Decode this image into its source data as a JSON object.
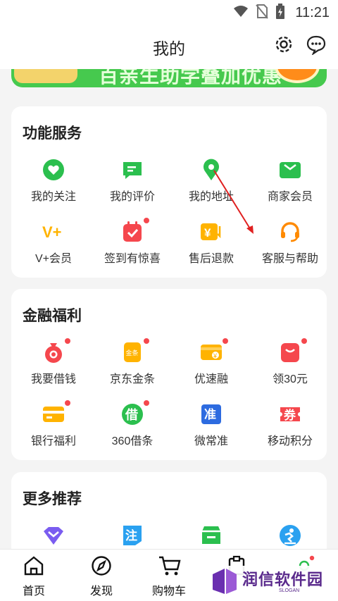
{
  "status_bar": {
    "time": "11:21",
    "icons": [
      "wifi-icon",
      "no-sim-icon",
      "battery-charging-icon"
    ]
  },
  "header": {
    "title": "我的",
    "icons": [
      "gear-icon",
      "message-bubble-icon"
    ]
  },
  "banner": {
    "text": "百亲生助学叠加优惠"
  },
  "services": {
    "title": "功能服务",
    "items": [
      {
        "label": "我的关注",
        "icon": "heart-icon",
        "color": "#2bbf4e",
        "badge": false
      },
      {
        "label": "我的评价",
        "icon": "comment-icon",
        "color": "#2bbf4e",
        "badge": false
      },
      {
        "label": "我的地址",
        "icon": "location-pin-icon",
        "color": "#2bbf4e",
        "badge": false
      },
      {
        "label": "商家会员",
        "icon": "member-card-icon",
        "color": "#2bbf4e",
        "badge": false
      },
      {
        "label": "V+会员",
        "icon": "vplus-icon",
        "color": "#ffb300",
        "badge": false
      },
      {
        "label": "签到有惊喜",
        "icon": "calendar-check-icon",
        "color": "#f5474d",
        "badge": true
      },
      {
        "label": "售后退款",
        "icon": "refund-icon",
        "color": "#ffb300",
        "badge": false
      },
      {
        "label": "客服与帮助",
        "icon": "headset-icon",
        "color": "#ff8a00",
        "badge": false
      }
    ]
  },
  "finance": {
    "title": "金融福利",
    "items": [
      {
        "label": "我要借钱",
        "icon": "money-bag-icon",
        "color": "#f5474d",
        "badge": true
      },
      {
        "label": "京东金条",
        "icon": "gold-bar-icon",
        "color": "#ffb300",
        "badge": true
      },
      {
        "label": "优速融",
        "icon": "wallet-icon",
        "color": "#ffb300",
        "badge": true
      },
      {
        "label": "领30元",
        "icon": "red-packet-icon",
        "color": "#f5474d",
        "badge": true
      },
      {
        "label": "银行福利",
        "icon": "bank-card-icon",
        "color": "#ffb300",
        "badge": true
      },
      {
        "label": "360借条",
        "icon": "borrow-icon",
        "color": "#2bbf4e",
        "badge": true
      },
      {
        "label": "微常准",
        "icon": "insurance-icon",
        "color": "#2d6be0",
        "badge": false
      },
      {
        "label": "移动积分",
        "icon": "coupon-icon",
        "color": "#f5474d",
        "badge": false
      }
    ],
    "glyphs": {
      "borrow": "借",
      "insurance": "准",
      "coupon": "券",
      "vplus": "V+",
      "gold_bar": "金条"
    }
  },
  "more": {
    "title": "更多推荐",
    "items": [
      {
        "icon": "crown-icon",
        "color": "#7a5cf0"
      },
      {
        "icon": "note-icon",
        "color": "#2aa1f0"
      },
      {
        "icon": "store-icon",
        "color": "#2bbf4e"
      },
      {
        "icon": "skating-icon",
        "color": "#2aa1f0"
      }
    ],
    "glyphs": {
      "note": "注"
    }
  },
  "bottom_nav": {
    "tabs": [
      {
        "label": "首页",
        "icon": "home-icon"
      },
      {
        "label": "发现",
        "icon": "compass-icon"
      },
      {
        "label": "购物车",
        "icon": "cart-icon"
      },
      {
        "label": "",
        "icon": "orders-icon"
      },
      {
        "label": "",
        "icon": "profile-icon"
      }
    ]
  },
  "watermark": {
    "text": "润信软件园",
    "slogan": "SLOGAN"
  },
  "annotation": {
    "arrow_color": "#e02020"
  }
}
